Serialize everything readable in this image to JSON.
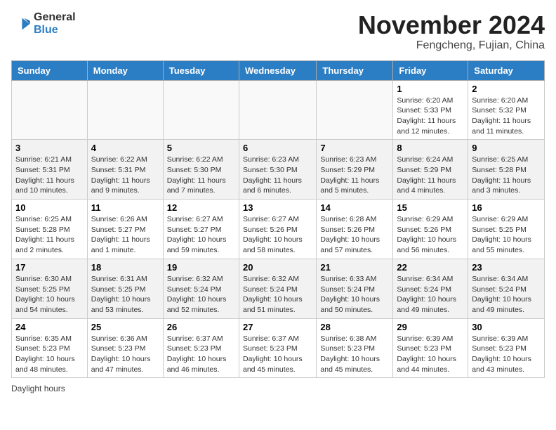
{
  "header": {
    "logo_general": "General",
    "logo_blue": "Blue",
    "month_title": "November 2024",
    "location": "Fengcheng, Fujian, China"
  },
  "weekdays": [
    "Sunday",
    "Monday",
    "Tuesday",
    "Wednesday",
    "Thursday",
    "Friday",
    "Saturday"
  ],
  "weeks": [
    [
      {
        "day": "",
        "info": ""
      },
      {
        "day": "",
        "info": ""
      },
      {
        "day": "",
        "info": ""
      },
      {
        "day": "",
        "info": ""
      },
      {
        "day": "",
        "info": ""
      },
      {
        "day": "1",
        "info": "Sunrise: 6:20 AM\nSunset: 5:33 PM\nDaylight: 11 hours and 12 minutes."
      },
      {
        "day": "2",
        "info": "Sunrise: 6:20 AM\nSunset: 5:32 PM\nDaylight: 11 hours and 11 minutes."
      }
    ],
    [
      {
        "day": "3",
        "info": "Sunrise: 6:21 AM\nSunset: 5:31 PM\nDaylight: 11 hours and 10 minutes."
      },
      {
        "day": "4",
        "info": "Sunrise: 6:22 AM\nSunset: 5:31 PM\nDaylight: 11 hours and 9 minutes."
      },
      {
        "day": "5",
        "info": "Sunrise: 6:22 AM\nSunset: 5:30 PM\nDaylight: 11 hours and 7 minutes."
      },
      {
        "day": "6",
        "info": "Sunrise: 6:23 AM\nSunset: 5:30 PM\nDaylight: 11 hours and 6 minutes."
      },
      {
        "day": "7",
        "info": "Sunrise: 6:23 AM\nSunset: 5:29 PM\nDaylight: 11 hours and 5 minutes."
      },
      {
        "day": "8",
        "info": "Sunrise: 6:24 AM\nSunset: 5:29 PM\nDaylight: 11 hours and 4 minutes."
      },
      {
        "day": "9",
        "info": "Sunrise: 6:25 AM\nSunset: 5:28 PM\nDaylight: 11 hours and 3 minutes."
      }
    ],
    [
      {
        "day": "10",
        "info": "Sunrise: 6:25 AM\nSunset: 5:28 PM\nDaylight: 11 hours and 2 minutes."
      },
      {
        "day": "11",
        "info": "Sunrise: 6:26 AM\nSunset: 5:27 PM\nDaylight: 11 hours and 1 minute."
      },
      {
        "day": "12",
        "info": "Sunrise: 6:27 AM\nSunset: 5:27 PM\nDaylight: 10 hours and 59 minutes."
      },
      {
        "day": "13",
        "info": "Sunrise: 6:27 AM\nSunset: 5:26 PM\nDaylight: 10 hours and 58 minutes."
      },
      {
        "day": "14",
        "info": "Sunrise: 6:28 AM\nSunset: 5:26 PM\nDaylight: 10 hours and 57 minutes."
      },
      {
        "day": "15",
        "info": "Sunrise: 6:29 AM\nSunset: 5:26 PM\nDaylight: 10 hours and 56 minutes."
      },
      {
        "day": "16",
        "info": "Sunrise: 6:29 AM\nSunset: 5:25 PM\nDaylight: 10 hours and 55 minutes."
      }
    ],
    [
      {
        "day": "17",
        "info": "Sunrise: 6:30 AM\nSunset: 5:25 PM\nDaylight: 10 hours and 54 minutes."
      },
      {
        "day": "18",
        "info": "Sunrise: 6:31 AM\nSunset: 5:25 PM\nDaylight: 10 hours and 53 minutes."
      },
      {
        "day": "19",
        "info": "Sunrise: 6:32 AM\nSunset: 5:24 PM\nDaylight: 10 hours and 52 minutes."
      },
      {
        "day": "20",
        "info": "Sunrise: 6:32 AM\nSunset: 5:24 PM\nDaylight: 10 hours and 51 minutes."
      },
      {
        "day": "21",
        "info": "Sunrise: 6:33 AM\nSunset: 5:24 PM\nDaylight: 10 hours and 50 minutes."
      },
      {
        "day": "22",
        "info": "Sunrise: 6:34 AM\nSunset: 5:24 PM\nDaylight: 10 hours and 49 minutes."
      },
      {
        "day": "23",
        "info": "Sunrise: 6:34 AM\nSunset: 5:24 PM\nDaylight: 10 hours and 49 minutes."
      }
    ],
    [
      {
        "day": "24",
        "info": "Sunrise: 6:35 AM\nSunset: 5:23 PM\nDaylight: 10 hours and 48 minutes."
      },
      {
        "day": "25",
        "info": "Sunrise: 6:36 AM\nSunset: 5:23 PM\nDaylight: 10 hours and 47 minutes."
      },
      {
        "day": "26",
        "info": "Sunrise: 6:37 AM\nSunset: 5:23 PM\nDaylight: 10 hours and 46 minutes."
      },
      {
        "day": "27",
        "info": "Sunrise: 6:37 AM\nSunset: 5:23 PM\nDaylight: 10 hours and 45 minutes."
      },
      {
        "day": "28",
        "info": "Sunrise: 6:38 AM\nSunset: 5:23 PM\nDaylight: 10 hours and 45 minutes."
      },
      {
        "day": "29",
        "info": "Sunrise: 6:39 AM\nSunset: 5:23 PM\nDaylight: 10 hours and 44 minutes."
      },
      {
        "day": "30",
        "info": "Sunrise: 6:39 AM\nSunset: 5:23 PM\nDaylight: 10 hours and 43 minutes."
      }
    ]
  ],
  "footer": {
    "daylight_label": "Daylight hours"
  }
}
